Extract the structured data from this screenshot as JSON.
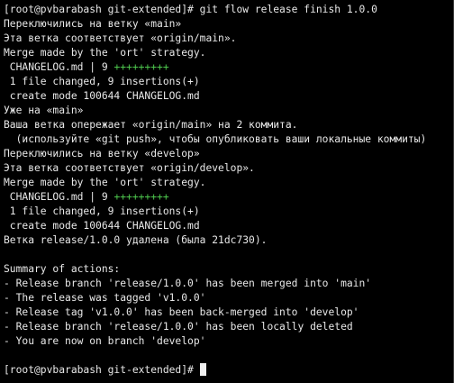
{
  "terminal": {
    "lines": [
      {
        "text": "[root@pvbarabash git-extended]# git flow release finish 1.0.0"
      },
      {
        "text": "Переключились на ветку «main»"
      },
      {
        "text": "Эта ветка соответствует «origin/main»."
      },
      {
        "text": "Merge made by the 'ort' strategy."
      },
      {
        "text": " CHANGELOG.md | 9 ",
        "plus": "+++++++++"
      },
      {
        "text": " 1 file changed, 9 insertions(+)"
      },
      {
        "text": " create mode 100644 CHANGELOG.md"
      },
      {
        "text": "Уже на «main»"
      },
      {
        "text": "Ваша ветка опережает «origin/main» на 2 коммита."
      },
      {
        "text": "  (используйте «git push», чтобы опубликовать ваши локальные коммиты)"
      },
      {
        "text": "Переключились на ветку «develop»"
      },
      {
        "text": "Эта ветка соответствует «origin/develop»."
      },
      {
        "text": "Merge made by the 'ort' strategy."
      },
      {
        "text": " CHANGELOG.md | 9 ",
        "plus": "+++++++++"
      },
      {
        "text": " 1 file changed, 9 insertions(+)"
      },
      {
        "text": " create mode 100644 CHANGELOG.md"
      },
      {
        "text": "Ветка release/1.0.0 удалена (была 21dc730)."
      },
      {
        "text": ""
      },
      {
        "text": "Summary of actions:"
      },
      {
        "text": "- Release branch 'release/1.0.0' has been merged into 'main'"
      },
      {
        "text": "- The release was tagged 'v1.0.0'"
      },
      {
        "text": "- Release tag 'v1.0.0' has been back-merged into 'develop'"
      },
      {
        "text": "- Release branch 'release/1.0.0' has been locally deleted"
      },
      {
        "text": "- You are now on branch 'develop'"
      },
      {
        "text": ""
      },
      {
        "text": "[root@pvbarabash git-extended]# "
      }
    ],
    "colors": {
      "background": "#000000",
      "foreground": "#e8e8e8",
      "diffstat_plus": "#4ec94e",
      "cursor": "#f0f0f0"
    }
  }
}
